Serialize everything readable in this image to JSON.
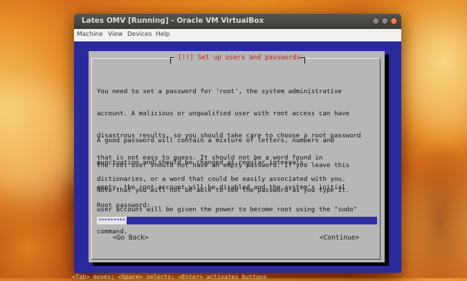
{
  "window": {
    "title": "Lates OMV [Running] - Oracle VM VirtualBox",
    "menu": [
      "Machine",
      "View",
      "Devices",
      "Help"
    ]
  },
  "installer": {
    "title": "[!!] Set up users and passwords",
    "paragraph1": [
      "You need to set a password for 'root', the system administrative",
      "account. A malicious or unqualified user with root access can have",
      "disastrous results, so you should take care to choose a root password",
      "that is not easy to guess. It should not be a word found in",
      "dictionaries, or a word that could be easily associated with you."
    ],
    "paragraph2": [
      "A good password will contain a mixture of letters, numbers and",
      "punctuation and should be changed at regular intervals."
    ],
    "paragraph3": [
      "The root user should not have an empty password. If you leave this",
      "empty, the root account will be disabled and the system's initial",
      "user account will be given the power to become root using the \"sudo\"",
      "command."
    ],
    "paragraph4": "Note that you will not be able to see the password as you type it.",
    "field_label": "Root password:",
    "field_value": "*********",
    "go_back": "<Go Back>",
    "continue": "<Continue>",
    "help": "<Tab> moves; <Space> selects; <Enter> activates buttons"
  },
  "colors": {
    "screen_bg": "#2a2a9c",
    "dialog_bg": "#b7b7b7",
    "title_red": "#c0251c"
  }
}
